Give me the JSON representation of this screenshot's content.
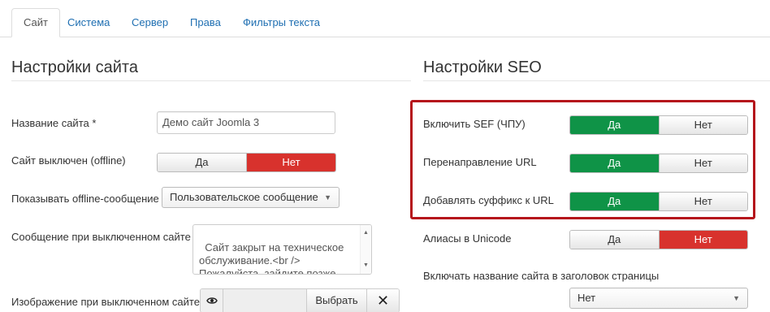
{
  "tabs": [
    {
      "label": "Сайт",
      "active": true
    },
    {
      "label": "Система",
      "active": false
    },
    {
      "label": "Сервер",
      "active": false
    },
    {
      "label": "Права",
      "active": false
    },
    {
      "label": "Фильтры текста",
      "active": false
    }
  ],
  "site_settings": {
    "title": "Настройки сайта",
    "site_name": {
      "label": "Название сайта *",
      "value": "Демо сайт Joomla 3"
    },
    "offline": {
      "label": "Сайт выключен (offline)",
      "yes": "Да",
      "no": "Нет",
      "selected": "Нет"
    },
    "offline_message": {
      "label": "Показывать offline-сообщение",
      "value": "Пользовательское сообщение"
    },
    "offline_text": {
      "label": "Сообщение при выключенном сайте",
      "value": "Сайт закрыт на техническое обслуживание.<br />\nПожалуйста, зайдите позже."
    },
    "offline_image": {
      "label": "Изображение при выключенном сайте",
      "select_label": "Выбрать",
      "clear_label": "✕"
    }
  },
  "seo_settings": {
    "title": "Настройки SEO",
    "sef": {
      "label": "Включить SEF (ЧПУ)",
      "yes": "Да",
      "no": "Нет",
      "selected": "Да"
    },
    "rewrite": {
      "label": "Перенаправление URL",
      "yes": "Да",
      "no": "Нет",
      "selected": "Да"
    },
    "suffix": {
      "label": "Добавлять суффикс к URL",
      "yes": "Да",
      "no": "Нет",
      "selected": "Да"
    },
    "unicode": {
      "label": "Алиасы в Unicode",
      "yes": "Да",
      "no": "Нет",
      "selected": "Нет"
    },
    "sitename_in_title": {
      "label": "Включать название сайта в заголовок страницы",
      "value": "Нет"
    }
  },
  "colors": {
    "accent_link": "#1f6fb2",
    "yes_active": "#0f9347",
    "no_active": "#d8322d",
    "highlight_border": "#b5141b"
  }
}
